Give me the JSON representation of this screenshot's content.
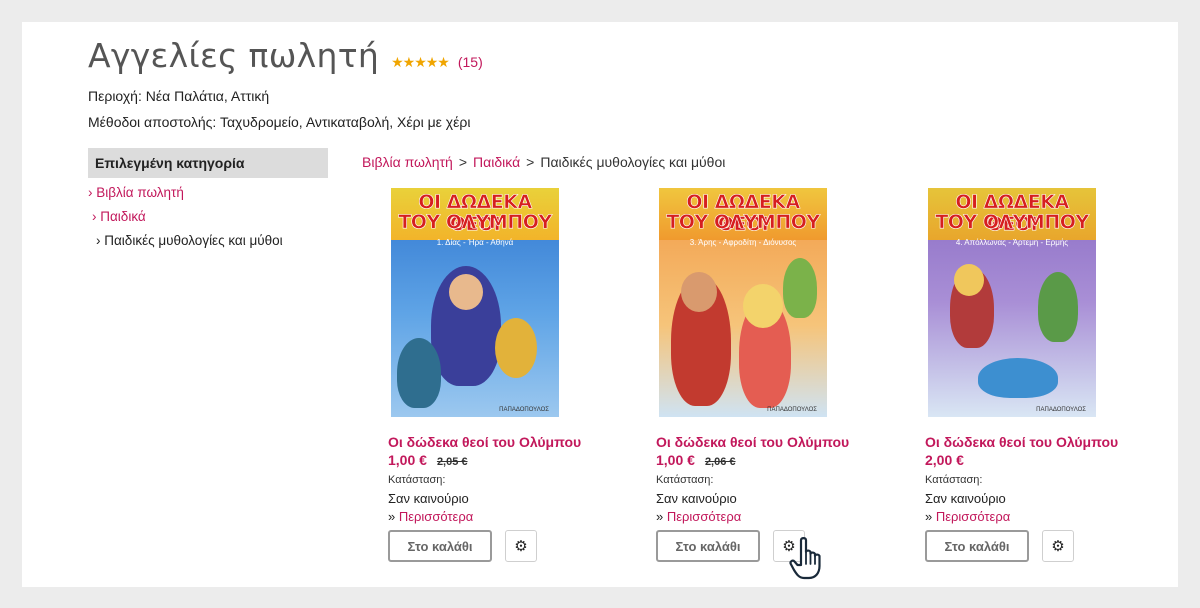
{
  "header": {
    "title": "Αγγελίες πωλητή",
    "stars": "★★★★★",
    "rating_count": "(15)",
    "region": "Περιοχή: Νέα Παλάτια, Αττική",
    "shipping": "Μέθοδοι αποστολής: Ταχυδρομείο, Αντικαταβολή, Χέρι με χέρι"
  },
  "sidebar": {
    "heading": "Επιλεγμένη κατηγορία",
    "categories": [
      "› Βιβλία πωλητή",
      "› Παιδικά",
      "› Παιδικές μυθολογίες και μύθοι"
    ]
  },
  "breadcrumb": {
    "items": [
      "Βιβλία πωλητή",
      "Παιδικά"
    ],
    "separator": ">",
    "current": "Παιδικές μυθολογίες και μύθοι"
  },
  "products": [
    {
      "cover_line1": "ΟΙ ΔΩΔΕΚΑ ΘΕΟΙ",
      "cover_line2": "ΤΟΥ ΟΛΥΜΠΟΥ",
      "cover_sub": "1. Δίας - Ήρα - Αθηνά",
      "cover_publisher": "ΠΑΠΑΔΟΠΟΥΛΟΣ",
      "name": "Οι δώδεκα θεοί του Ολύμπου",
      "price": "1,00 €",
      "old_price": "2,05 €",
      "condition_label": "Κατάσταση:",
      "condition": "Σαν καινούριο",
      "more_prefix": "» ",
      "more": "Περισσότερα",
      "cart": "Στο καλάθι"
    },
    {
      "cover_line1": "ΟΙ ΔΩΔΕΚΑ ΘΕΟΙ",
      "cover_line2": "ΤΟΥ ΟΛΥΜΠΟΥ",
      "cover_sub": "3. Άρης - Αφροδίτη - Διόνυσος",
      "cover_publisher": "ΠΑΠΑΔΟΠΟΥΛΟΣ",
      "name": "Οι δώδεκα θεοί του Ολύμπου",
      "price": "1,00 €",
      "old_price": "2,06 €",
      "condition_label": "Κατάσταση:",
      "condition": "Σαν καινούριο",
      "more_prefix": "» ",
      "more": "Περισσότερα",
      "cart": "Στο καλάθι"
    },
    {
      "cover_line1": "ΟΙ ΔΩΔΕΚΑ ΘΕΟΙ",
      "cover_line2": "ΤΟΥ ΟΛΥΜΠΟΥ",
      "cover_sub": "4. Απόλλωνας - Άρτεμη - Ερμής",
      "cover_publisher": "ΠΑΠΑΔΟΠΟΥΛΟΣ",
      "name": "Οι δώδεκα θεοί του Ολύμπου",
      "price": "2,00 €",
      "old_price": "",
      "condition_label": "Κατάσταση:",
      "condition": "Σαν καινούριο",
      "more_prefix": "» ",
      "more": "Περισσότερα",
      "cart": "Στο καλάθι"
    }
  ],
  "icons": {
    "gear": "gear-icon",
    "cursor": "hand-pointer-icon"
  },
  "colors": {
    "accent": "#c2185b",
    "star": "#f0a500"
  }
}
